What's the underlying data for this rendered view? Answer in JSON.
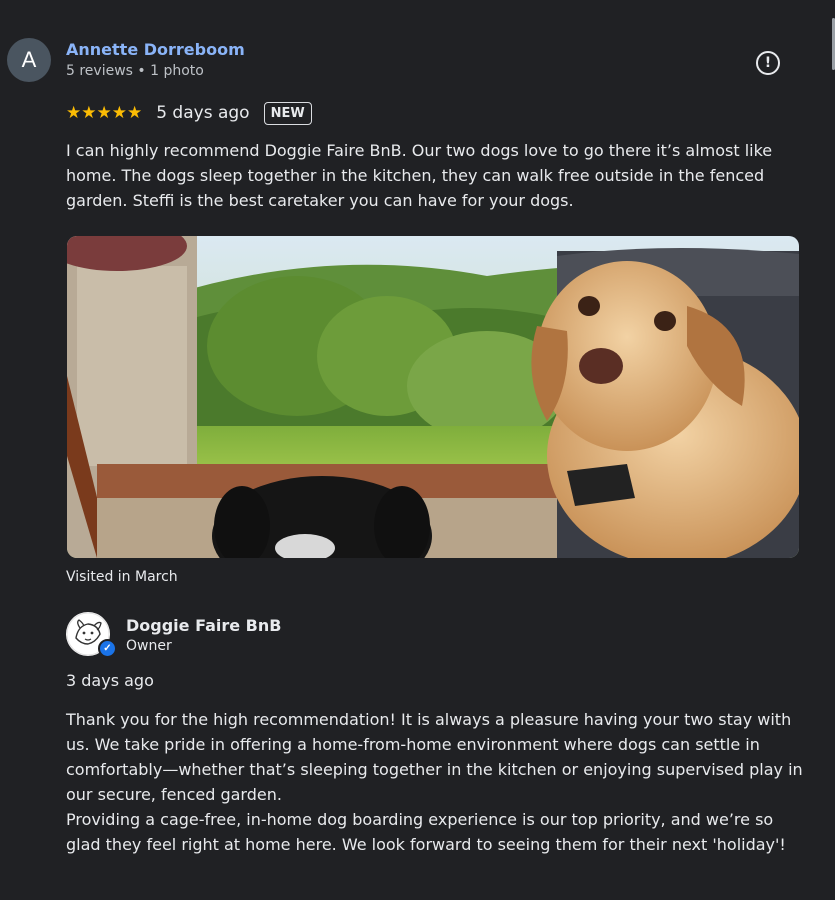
{
  "reviewer": {
    "initial": "A",
    "name": "Annette Dorreboom",
    "meta": "5 reviews • 1 photo"
  },
  "review": {
    "stars": "★★★★★",
    "rating": 5,
    "date": "5 days ago",
    "badge": "NEW",
    "text": "I can highly recommend Doggie Faire BnB. Our two dogs love to go there it’s almost like home. The dogs sleep together in the kitchen, they can walk free outside in the fenced garden. Steffi is the best caretaker you can have for your dogs.",
    "visit_note": "Visited in March",
    "star_color": "#fbbc04",
    "name_color": "#8ab4f8"
  },
  "owner_reply": {
    "name": "Doggie Faire BnB",
    "role": "Owner",
    "date": "3 days ago",
    "paragraph_1": "Thank you for the high recommendation! It is always a pleasure having your two stay with us. We take pride in offering a home-from-home environment where dogs can settle in comfortably—whether that’s sleeping together in the kitchen or enjoying supervised play in our secure, fenced garden.",
    "paragraph_2": "Providing a cage-free, in-home dog boarding experience is our top priority, and we’re so glad they feel right at home here. We look forward to seeing them for their next 'holiday'!",
    "verified_color": "#1a73e8"
  },
  "icons": {
    "info": "info-icon",
    "verified": "verified-check-icon",
    "owner_logo": "dog-logo-icon"
  }
}
